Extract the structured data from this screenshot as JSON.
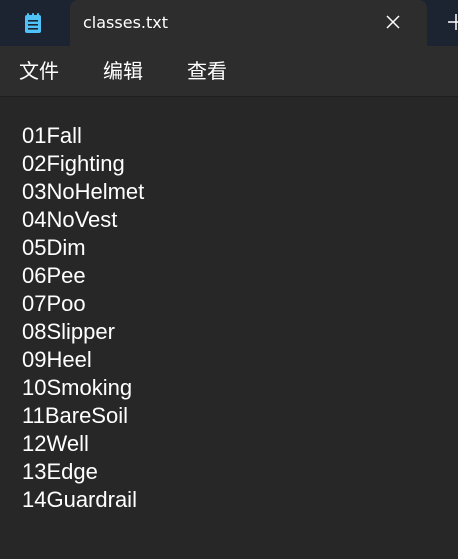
{
  "window": {
    "tab_title": "classes.txt",
    "app_icon": "notepad-icon",
    "close_icon": "close-icon",
    "new_tab_icon": "plus-icon"
  },
  "menu": {
    "file": "文件",
    "edit": "编辑",
    "view": "查看"
  },
  "content": {
    "lines": [
      "01Fall",
      "02Fighting",
      "03NoHelmet",
      "04NoVest",
      "05Dim",
      "06Pee",
      "07Poo",
      "08Slipper",
      "09Heel",
      "10Smoking",
      "11BareSoil",
      "12Well",
      "13Edge",
      "14Guardrail"
    ]
  },
  "colors": {
    "titlebar": "#1c2331",
    "tab": "#2d2d2d",
    "editor_bg": "#272727",
    "text": "#ffffff",
    "icon_accent": "#4fc3f7"
  }
}
